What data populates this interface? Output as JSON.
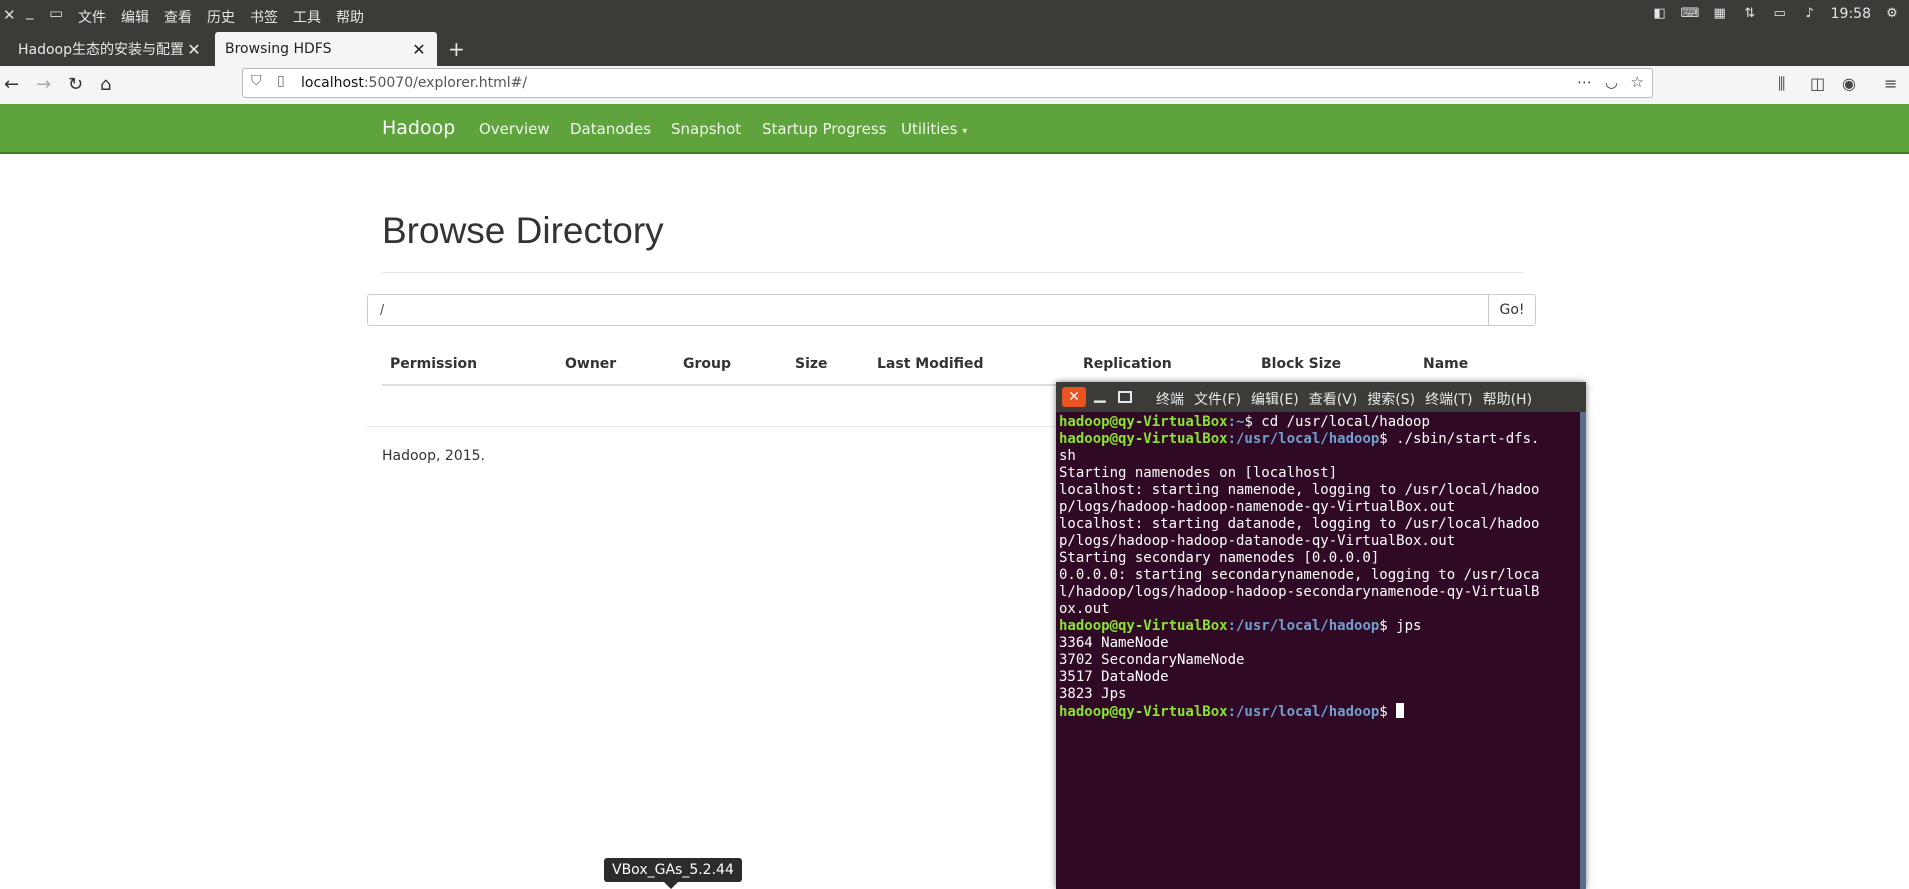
{
  "os": {
    "menu": [
      "文件",
      "编辑",
      "查看",
      "历史",
      "书签",
      "工具",
      "帮助"
    ],
    "clock": "19:58"
  },
  "browser": {
    "tabs": [
      {
        "title": "Hadoop生态的安装与配置",
        "active": false
      },
      {
        "title": "Browsing HDFS",
        "active": true
      }
    ],
    "url_host": "localhost",
    "url_rest": ":50070/explorer.html#/"
  },
  "hadoop": {
    "brand": "Hadoop",
    "nav": [
      "Overview",
      "Datanodes",
      "Snapshot",
      "Startup Progress",
      "Utilities"
    ],
    "title": "Browse Directory",
    "path_value": "/",
    "go_label": "Go!",
    "columns": [
      "Permission",
      "Owner",
      "Group",
      "Size",
      "Last Modified",
      "Replication",
      "Block Size",
      "Name"
    ],
    "footer": "Hadoop, 2015."
  },
  "terminal": {
    "menu": [
      "终端",
      "文件(F)",
      "编辑(E)",
      "查看(V)",
      "搜索(S)",
      "终端(T)",
      "帮助(H)"
    ],
    "prompt_user": "hadoop@qy-VirtualBox",
    "home_path": ":~",
    "hadoop_path": ":/usr/local/hadoop",
    "cmd1": "$ cd /usr/local/hadoop",
    "cmd2a": "$ ./sbin/start-dfs.",
    "cmd2b": "sh",
    "out1": "Starting namenodes on [localhost]",
    "out2": "localhost: starting namenode, logging to /usr/local/hadoo",
    "out3": "p/logs/hadoop-hadoop-namenode-qy-VirtualBox.out",
    "out4": "localhost: starting datanode, logging to /usr/local/hadoo",
    "out5": "p/logs/hadoop-hadoop-datanode-qy-VirtualBox.out",
    "out6": "Starting secondary namenodes [0.0.0.0]",
    "out7": "0.0.0.0: starting secondarynamenode, logging to /usr/loca",
    "out8": "l/hadoop/logs/hadoop-hadoop-secondarynamenode-qy-VirtualB",
    "out9": "ox.out",
    "cmd3": "$ jps",
    "jps1": "3364 NameNode",
    "jps2": "3702 SecondaryNameNode",
    "jps3": "3517 DataNode",
    "jps4": "3823 Jps",
    "cmd4": "$ "
  },
  "tooltip": "VBox_GAs_5.2.44"
}
